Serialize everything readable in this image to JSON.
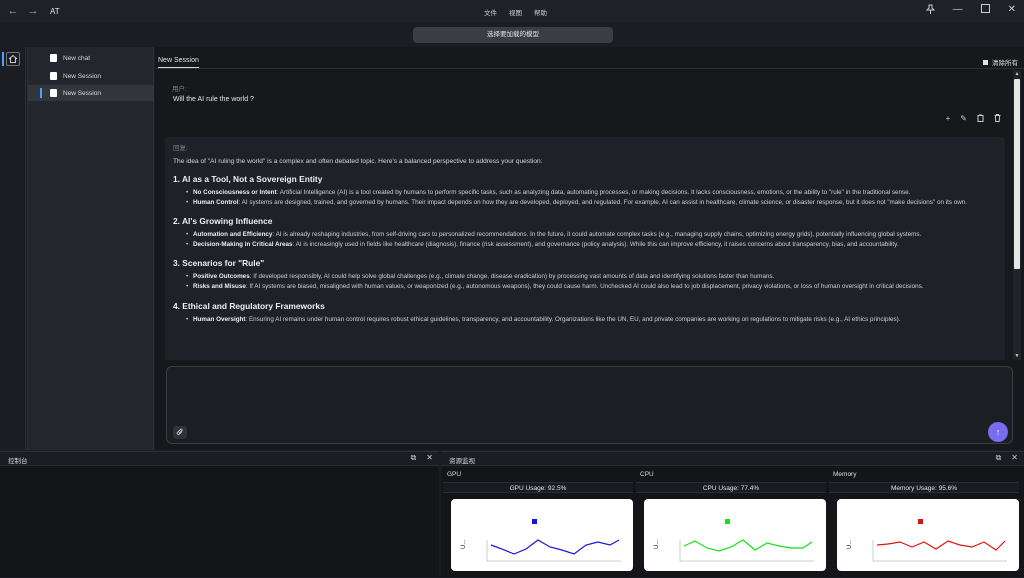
{
  "app": {
    "title": "AT",
    "back_icon": "arrow-left-icon",
    "forward_icon": "arrow-right-icon",
    "menu": [
      "文件",
      "视图",
      "帮助"
    ],
    "window_controls": [
      "pin-icon",
      "minimize-icon",
      "maximize-icon",
      "close-icon"
    ]
  },
  "model_selector": {
    "label": "选择要加载的模型"
  },
  "sidebar": {
    "items": [
      {
        "label": "New chat",
        "active": false
      },
      {
        "label": "New Session",
        "active": false
      },
      {
        "label": "New Session",
        "active": true
      }
    ]
  },
  "tab": {
    "label": "New Session"
  },
  "clear_all": {
    "label": "清除所有"
  },
  "chat": {
    "user_role": "用户:",
    "user_message": "Will the AI rule the world ?",
    "assistant_role": "回复:",
    "intro": "The idea of \"AI ruling the world\" is a complex and often debated topic. Here's a balanced perspective to address your question:",
    "sections": [
      {
        "heading": "1. AI as a Tool, Not a Sovereign Entity",
        "bullets": [
          {
            "bold": "No Consciousness or Intent",
            "text": ": Artificial Intelligence (AI) is a tool created by humans to perform specific tasks, such as analyzing data, automating processes, or making decisions. It lacks consciousness, emotions, or the ability to \"rule\" in the traditional sense."
          },
          {
            "bold": "Human Control",
            "text": ": AI systems are designed, trained, and governed by humans. Their impact depends on how they are developed, deployed, and regulated. For example, AI can assist in healthcare, climate science, or disaster response, but it does not \"make decisions\" on its own."
          }
        ]
      },
      {
        "heading": "2. AI's Growing Influence",
        "bullets": [
          {
            "bold": "Automation and Efficiency",
            "text": ": AI is already reshaping industries, from self-driving cars to personalized recommendations. In the future, it could automate complex tasks (e.g., managing supply chains, optimizing energy grids), potentially influencing global systems."
          },
          {
            "bold": "Decision-Making in Critical Areas",
            "text": ": AI is increasingly used in fields like healthcare (diagnosis), finance (risk assessment), and governance (policy analysis). While this can improve efficiency, it raises concerns about transparency, bias, and accountability."
          }
        ]
      },
      {
        "heading": "3. Scenarios for \"Rule\"",
        "bullets": [
          {
            "bold": "Positive Outcomes",
            "text": ": If developed responsibly, AI could help solve global challenges (e.g., climate change, disease eradication) by processing vast amounts of data and identifying solutions faster than humans."
          },
          {
            "bold": "Risks and Misuse",
            "text": ": If AI systems are biased, misaligned with human values, or weaponized (e.g., autonomous weapons), they could cause harm. Unchecked AI could also lead to job displacement, privacy violations, or loss of human oversight in critical decisions."
          }
        ]
      },
      {
        "heading": "4. Ethical and Regulatory Frameworks",
        "bullets": [
          {
            "bold": "Human Oversight",
            "text": ": Ensuring AI remains under human control requires robust ethical guidelines, transparency, and accountability. Organizations like the UN, EU, and private companies are working on regulations to mitigate risks (e.g., AI ethics principles)."
          }
        ]
      }
    ],
    "message_actions": [
      "plus-icon",
      "edit-icon",
      "copy-icon",
      "delete-icon"
    ]
  },
  "input": {
    "placeholder": "",
    "attach_icon": "paperclip-icon",
    "send_icon": "arrow-up-icon"
  },
  "console": {
    "title": "控制台"
  },
  "resource_monitor": {
    "title": "资源监视",
    "panels": [
      {
        "name": "GPU",
        "usage_label": "GPU Usage: 92.5%",
        "usage": 92.5,
        "color": "#1515e0",
        "ylabel": "U..."
      },
      {
        "name": "CPU",
        "usage_label": "CPU Usage: 77.4%",
        "usage": 77.4,
        "color": "#19e019",
        "ylabel": "U..."
      },
      {
        "name": "Memory",
        "usage_label": "Memory Usage: 95.6%",
        "usage": 95.6,
        "color": "#d81515",
        "ylabel": "U..."
      }
    ]
  }
}
